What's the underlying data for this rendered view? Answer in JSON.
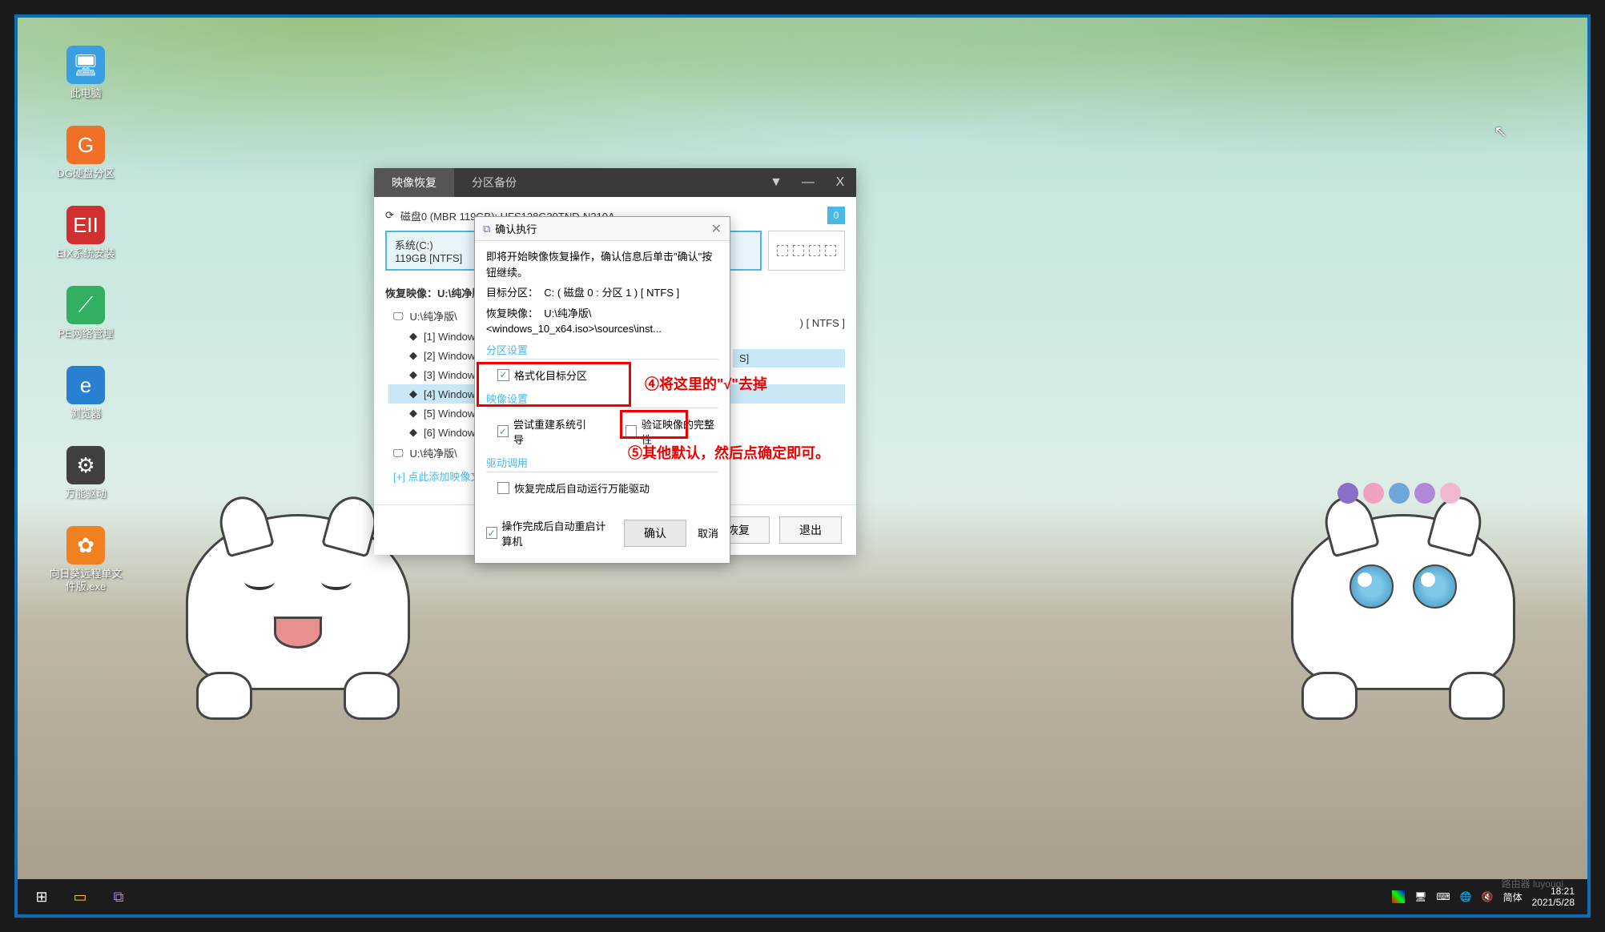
{
  "desktop": {
    "icons": [
      {
        "label": "此电脑",
        "bg": "#3a9fe0",
        "glyph": "🖥"
      },
      {
        "label": "DG硬盘分区",
        "bg": "#f07028",
        "glyph": "G"
      },
      {
        "label": "EIX系统安装",
        "bg": "#d03030",
        "glyph": "EII"
      },
      {
        "label": "PE网络管理",
        "bg": "#30b060",
        "glyph": "⟋"
      },
      {
        "label": "浏览器",
        "bg": "#2a80d0",
        "glyph": "e"
      },
      {
        "label": "万能驱动",
        "bg": "#404040",
        "glyph": "⚙"
      },
      {
        "label": "向日葵远程单文件版.exe",
        "bg": "#f08020",
        "glyph": "✿"
      }
    ]
  },
  "mainWindow": {
    "tabs": {
      "restore": "映像恢复",
      "backup": "分区备份"
    },
    "disk": "磁盘0 (MBR 119GB): HFS128G39TND-N210A",
    "diskBadge": "0",
    "partition": {
      "name": "系统(C:)",
      "size": "119GB [NTFS]"
    },
    "recoverLabel": "恢复映像：",
    "recoverPrefix": "U:\\纯净版\\<",
    "tree": {
      "root": "U:\\纯净版\\<window",
      "items": [
        "[1] Windows 10",
        "[2] Windows 10",
        "[3] Windows 10",
        "[4] Windows 10",
        "[5] Windows 10",
        "[6] Windows 10"
      ],
      "root2": "U:\\纯净版\\<window",
      "add": "[+] 点此添加映像文件到方案"
    },
    "sideNtfs": ") [ NTFS ]",
    "sideItem": "S]",
    "footer": {
      "restore": "一键恢复",
      "exit": "退出"
    }
  },
  "dialog": {
    "title": "确认执行",
    "msg": "即将开始映像恢复操作，确认信息后单击\"确认\"按钮继续。",
    "targetLabel": "目标分区：",
    "targetValue": "C: ( 磁盘 0 : 分区 1 ) [ NTFS ]",
    "imageLabel": "恢复映像：",
    "imageValue": "U:\\纯净版\\<windows_10_x64.iso>\\sources\\inst...",
    "sec1": "分区设置",
    "chk1": "格式化目标分区",
    "sec2": "映像设置",
    "chk2": "尝试重建系统引导",
    "chk3": "验证映像的完整性",
    "sec3": "驱动调用",
    "chk4": "恢复完成后自动运行万能驱动",
    "chk5": "操作完成后自动重启计算机",
    "ok": "确认",
    "cancel": "取消"
  },
  "annotations": {
    "a1": "④将这里的\"√\"去掉",
    "a2": "⑤其他默认，然后点确定即可。"
  },
  "taskbar": {
    "lang": "简体",
    "time": "18:21",
    "date": "2021/5/28"
  },
  "watermark": "路由器 luyouqi"
}
